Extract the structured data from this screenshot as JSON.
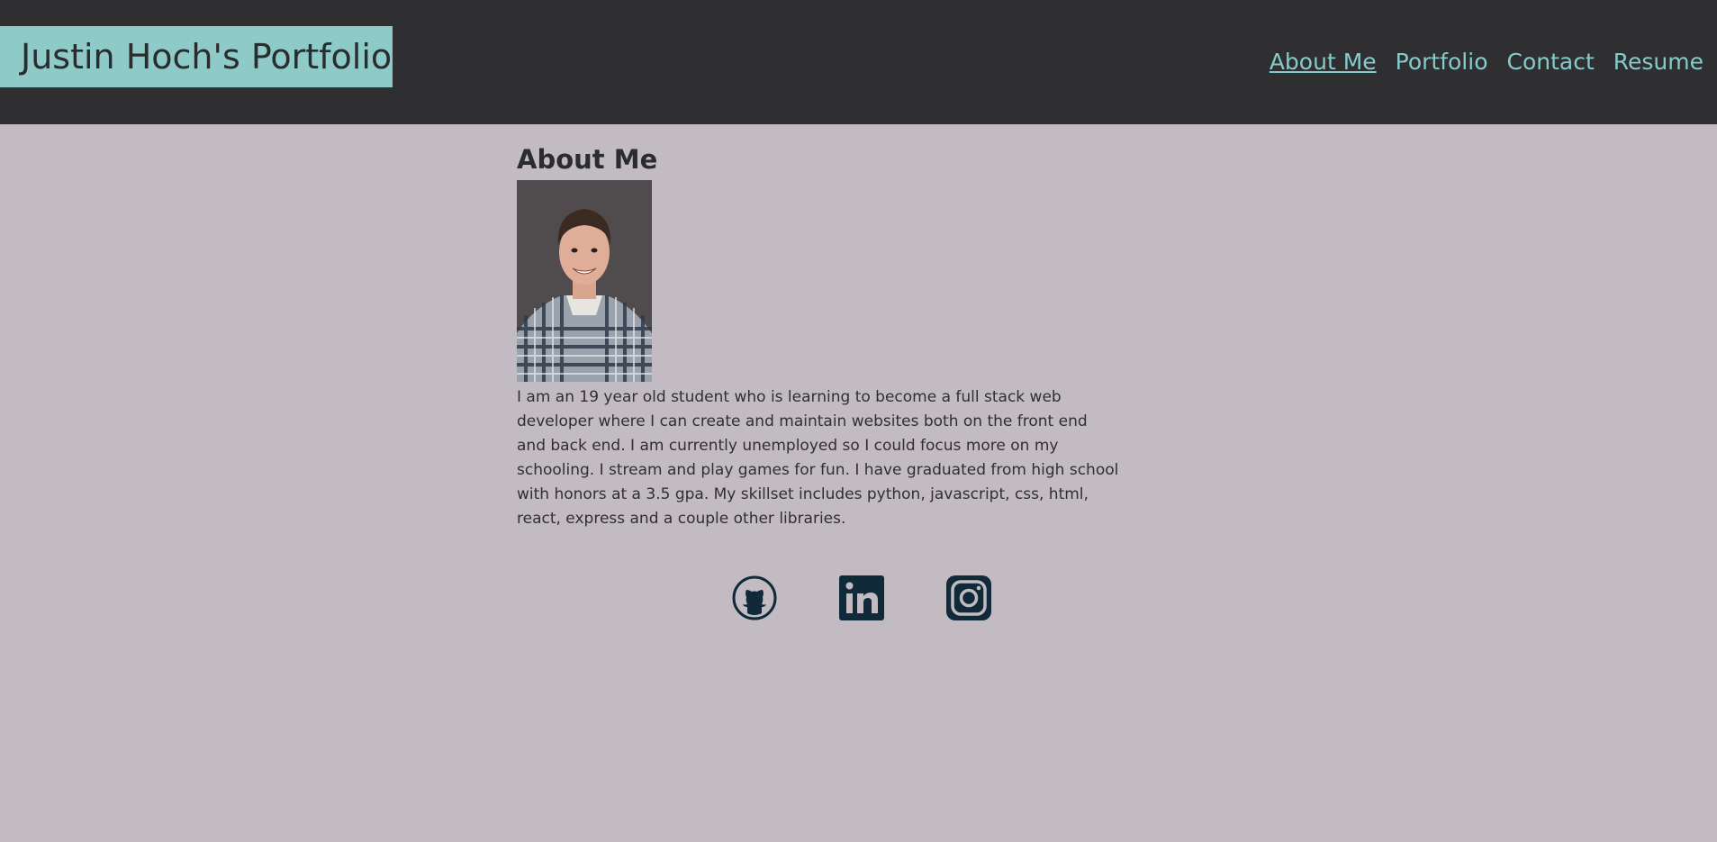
{
  "header": {
    "title": "Justin Hoch's Portfolio",
    "nav": [
      {
        "label": "About Me",
        "active": true
      },
      {
        "label": "Portfolio",
        "active": false
      },
      {
        "label": "Contact",
        "active": false
      },
      {
        "label": "Resume",
        "active": false
      }
    ]
  },
  "about": {
    "heading": "About Me",
    "bio": "I am an 19 year old student who is learning to become a full stack web developer where I can create and maintain websites both on the front end and back end. I am currently unemployed so I could focus more on my schooling. I stream and play games for fun. I have graduated from high school with honors at a 3.5 gpa. My skillset includes python, javascript, css, html, react, express and a couple other libraries."
  },
  "socials": [
    {
      "icon": "github-icon"
    },
    {
      "icon": "linkedin-icon"
    },
    {
      "icon": "instagram-icon"
    }
  ],
  "colors": {
    "header_bg": "#2f2f31",
    "brand_bg": "#8ecac8",
    "nav_link": "#86cbcb",
    "page_bg": "#c2bcc2",
    "icon": "#102a3a"
  }
}
